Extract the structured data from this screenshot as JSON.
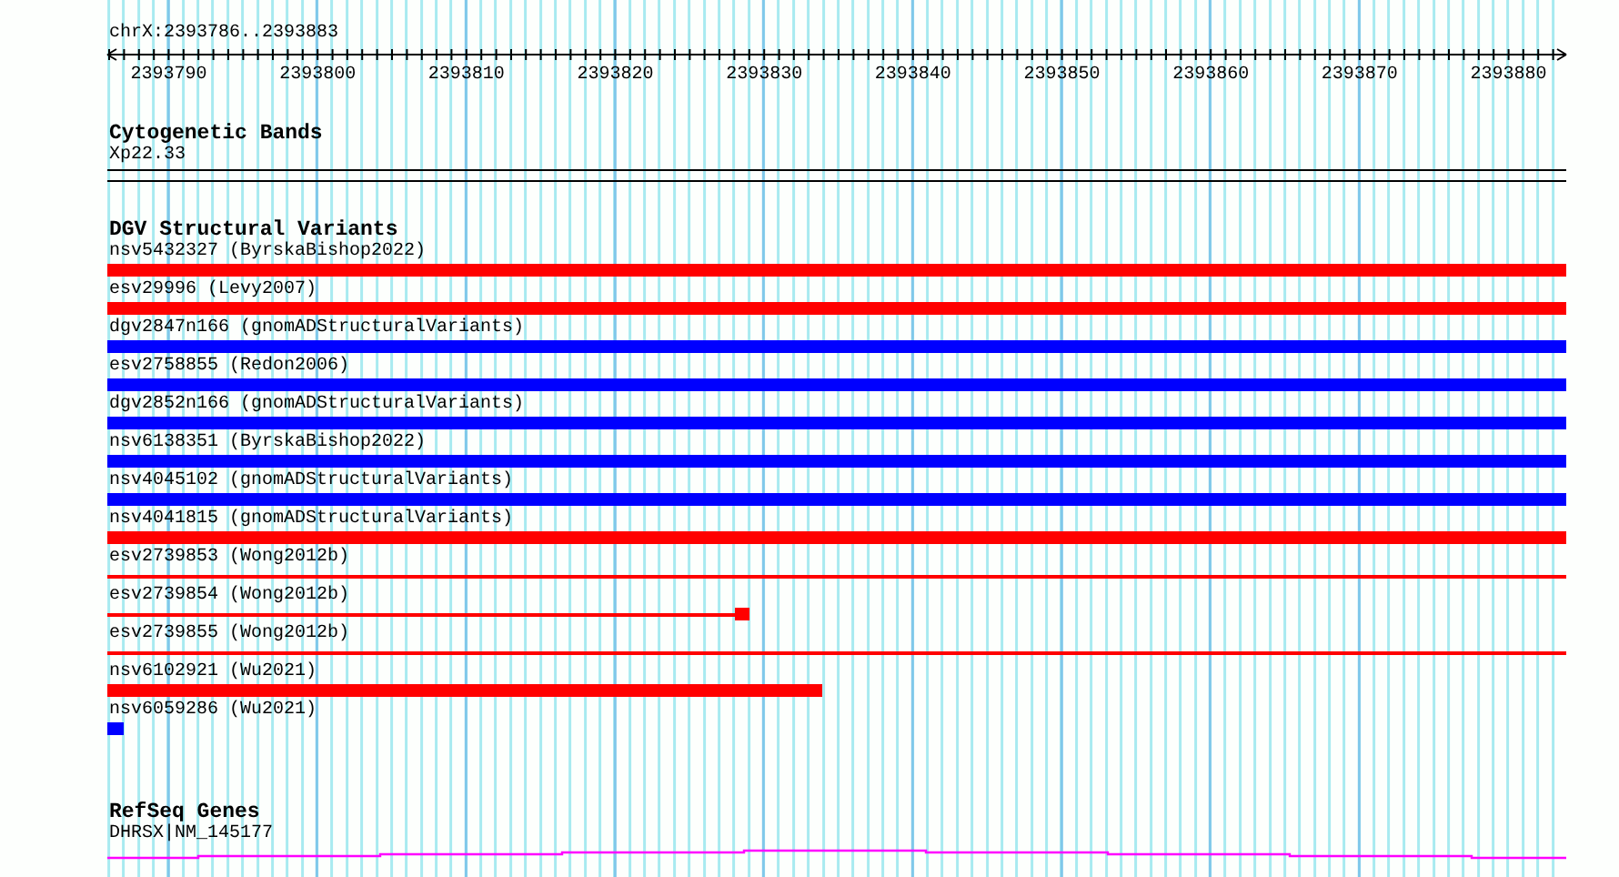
{
  "ruler": {
    "title": "chrX:2393786..2393883",
    "ticks": [
      "2393790",
      "2393800",
      "2393810",
      "2393820",
      "2393830",
      "2393840",
      "2393850",
      "2393860",
      "2393870",
      "2393880"
    ]
  },
  "cytogenetic_bands": {
    "title": "Cytogenetic Bands",
    "band": "Xp22.33"
  },
  "dgv_structural_variants": {
    "title": "DGV Structural Variants",
    "variants": [
      {
        "label": "nsv5432327 (ByrskaBishop2022)",
        "kind": "bar",
        "color": "#ff0000",
        "level": 1
      },
      {
        "label": "esv29996 (Levy2007)",
        "kind": "bar",
        "color": "#ff0000",
        "level": 1
      },
      {
        "label": "dgv2847n166 (gnomADStructuralVariants)",
        "kind": "bar",
        "color": "#0000ff",
        "level": 1
      },
      {
        "label": "esv2758855 (Redon2006)",
        "kind": "bar",
        "color": "#0000ff",
        "level": 1
      },
      {
        "label": "dgv2852n166 (gnomADStructuralVariants)",
        "kind": "bar",
        "color": "#0000ff",
        "level": 1
      },
      {
        "label": "nsv6138351 (ByrskaBishop2022)",
        "kind": "bar",
        "color": "#0000ff",
        "level": 1
      },
      {
        "label": "nsv4045102 (gnomADStructuralVariants)",
        "kind": "bar",
        "color": "#0000ff",
        "level": 1
      },
      {
        "label": "nsv4041815 (gnomADStructuralVariants)",
        "kind": "bar",
        "color": "#ff0000",
        "level": 1
      },
      {
        "label": "esv2739853 (Wong2012b)",
        "kind": "line",
        "color": "#ff0000",
        "level": 1
      },
      {
        "label": "esv2739854 (Wong2012b)",
        "kind": "line-block",
        "color": "#ff0000",
        "level": 0.44
      },
      {
        "label": "esv2739855 (Wong2012b)",
        "kind": "line",
        "color": "#ff0000",
        "level": 1
      },
      {
        "label": "nsv6102921 (Wu2021)",
        "kind": "bar",
        "color": "#ff0000",
        "level": 0.49
      },
      {
        "label": "nsv6059286 (Wu2021)",
        "kind": "bar",
        "color": "#0000ff",
        "level": 0.011
      }
    ]
  },
  "refseq_genes": {
    "title": "RefSeq Genes",
    "gene": "DHRSX|NM_145177"
  }
}
